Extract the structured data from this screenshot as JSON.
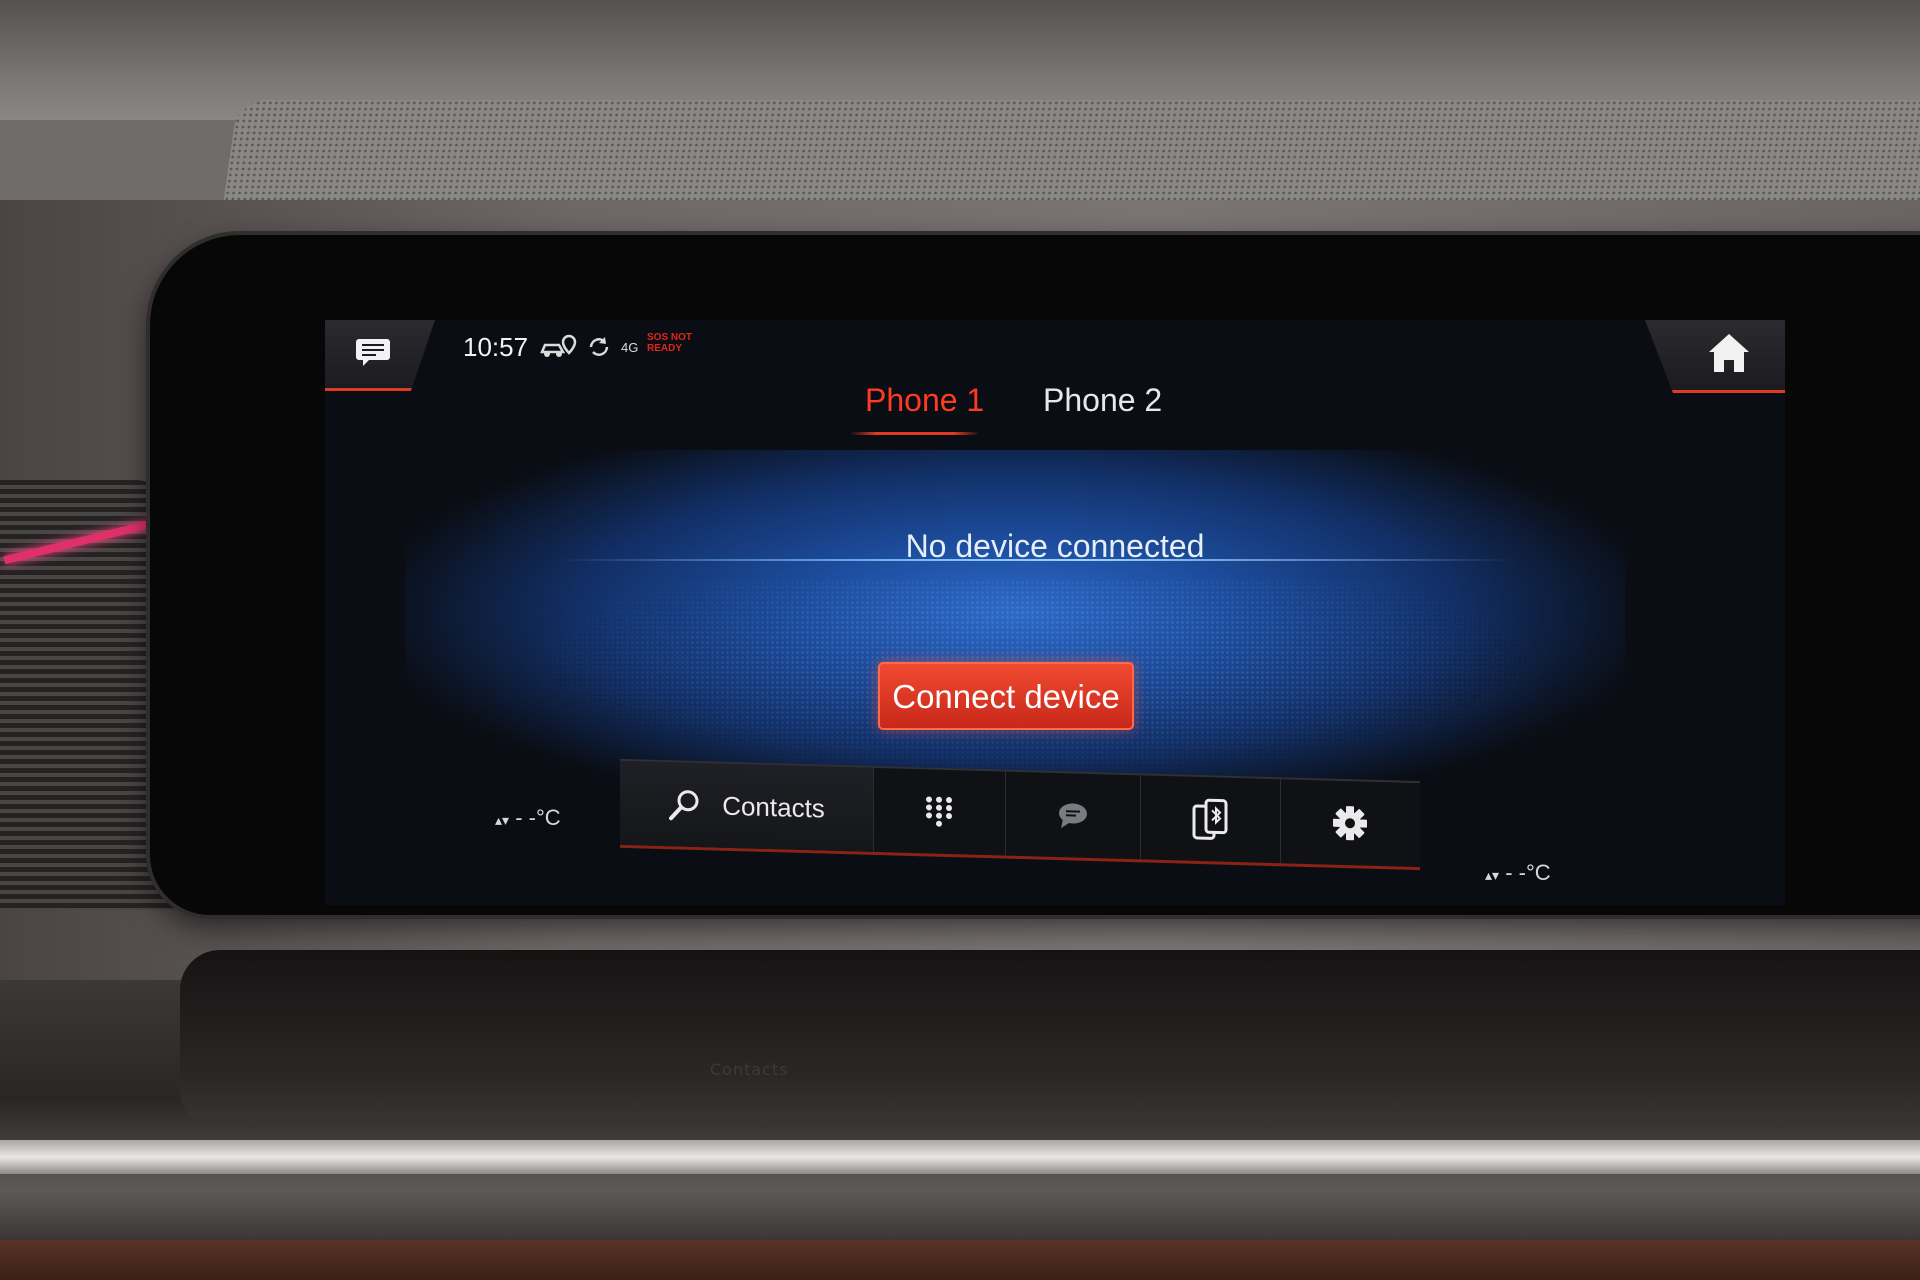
{
  "status_bar": {
    "time": "10:57",
    "sos_line1": "SOS NOT",
    "sos_line2": "READY",
    "network": "4G"
  },
  "tabs": [
    {
      "label": "Phone 1",
      "active": true
    },
    {
      "label": "Phone 2",
      "active": false
    }
  ],
  "main": {
    "status_text": "No device connected",
    "connect_button": "Connect device"
  },
  "bottom_bar": {
    "contacts_label": "Contacts",
    "icons": [
      "search-icon",
      "keypad-icon",
      "message-icon",
      "device-manager-icon",
      "settings-icon"
    ]
  },
  "climate": {
    "left_temp": "- -°C",
    "right_temp": "- -°C"
  },
  "reflection_text": "Contacts",
  "colors": {
    "accent": "#e03a22",
    "glow": "#2d6ac8",
    "text": "#e8e8e8"
  }
}
